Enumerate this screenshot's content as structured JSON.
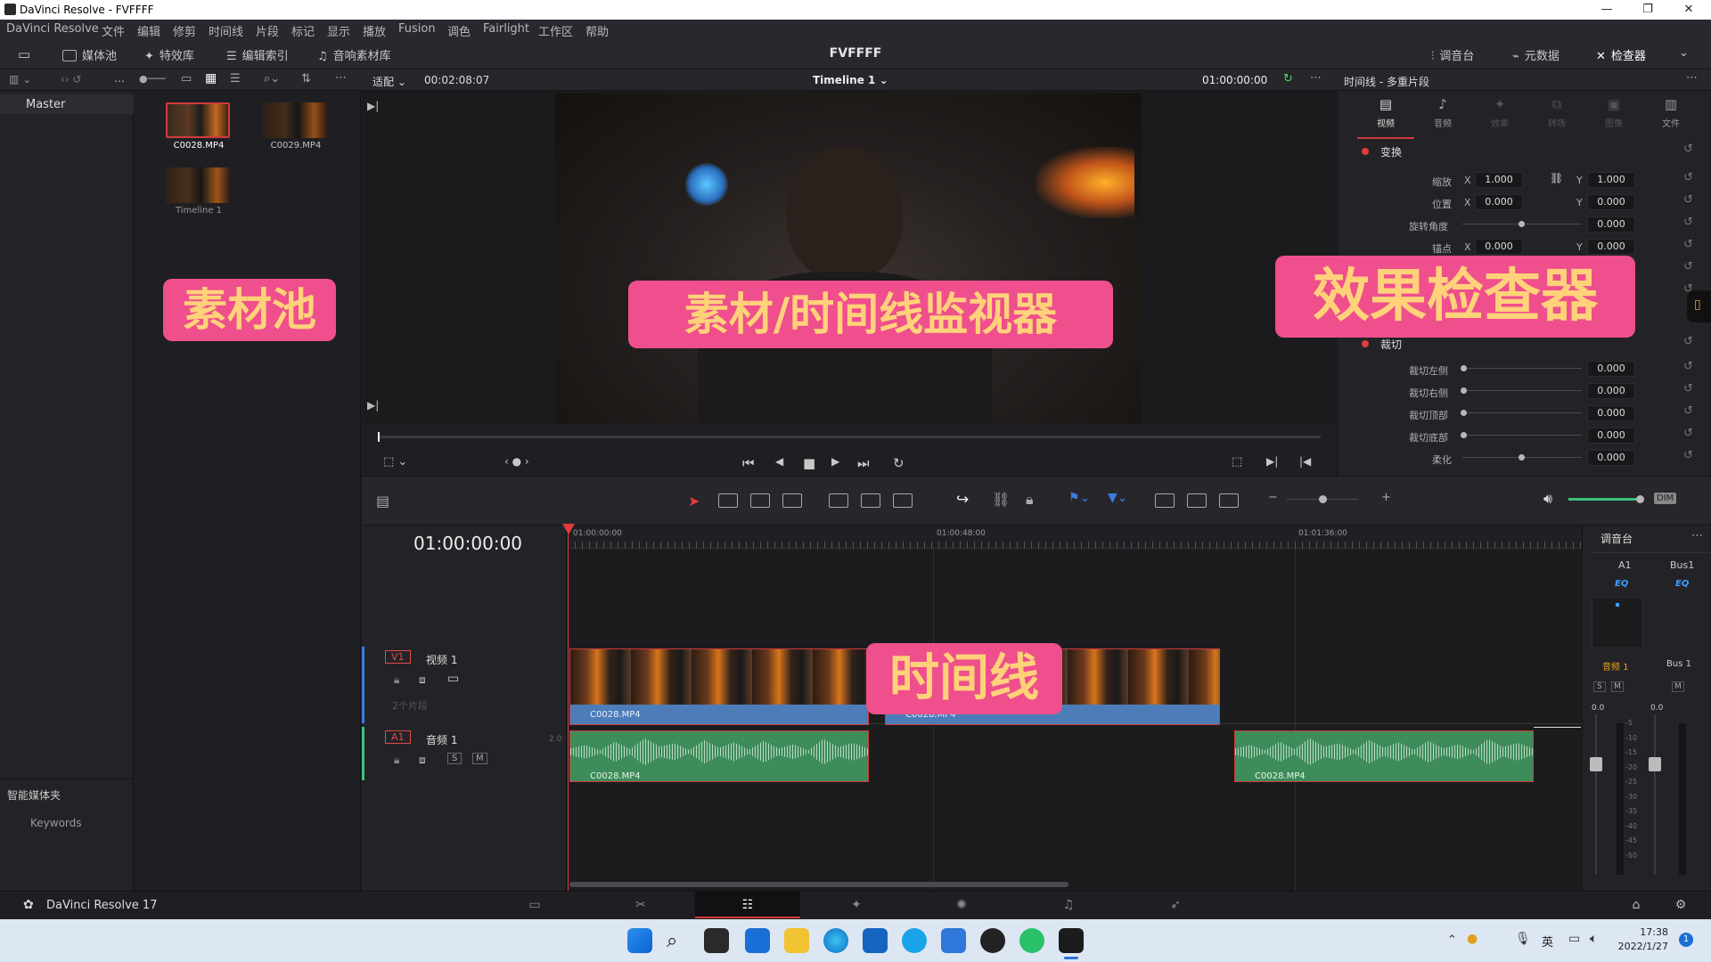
{
  "window": {
    "title": "DaVinci Resolve - FVFFFF",
    "controls": [
      "—",
      "❐",
      "✕"
    ]
  },
  "menu": [
    "DaVinci Resolve",
    "文件",
    "编辑",
    "修剪",
    "时间线",
    "片段",
    "标记",
    "显示",
    "播放",
    "Fusion",
    "调色",
    "Fairlight",
    "工作区",
    "帮助"
  ],
  "toolbar": {
    "media_pool": "媒体池",
    "effects": "特效库",
    "edit_index": "编辑索引",
    "sound_library": "音响素材库",
    "project_title": "FVFFFF",
    "mixer": "调音台",
    "metadata": "元数据",
    "inspector": "检查器"
  },
  "subbar": {
    "fit": "适配",
    "source_tc": "00:02:08:07",
    "timeline_name": "Timeline 1",
    "record_tc": "01:00:00:00",
    "inspector_title": "时间线 - 多重片段"
  },
  "bins": {
    "master": "Master",
    "smart_bins": "智能媒体夹",
    "keywords": "Keywords"
  },
  "media": {
    "clips": [
      {
        "name": "C0028.MP4"
      },
      {
        "name": "C0029.MP4"
      },
      {
        "name": "Timeline 1"
      }
    ]
  },
  "inspector": {
    "tabs": [
      "视频",
      "音频",
      "效果",
      "转场",
      "图像",
      "文件"
    ],
    "transform_label": "变换",
    "rows": [
      {
        "label": "缩放",
        "x": "1.000",
        "y": "1.000"
      },
      {
        "label": "位置",
        "x": "0.000",
        "y": "0.000"
      },
      {
        "label": "旋转角度",
        "value": "0.000"
      },
      {
        "label": "锚点",
        "x": "0.000",
        "y": "0.000"
      }
    ],
    "crop_label": "裁切",
    "crop_rows": [
      {
        "label": "裁切左侧",
        "value": "0.000"
      },
      {
        "label": "裁切右侧",
        "value": "0.000"
      },
      {
        "label": "裁切顶部",
        "value": "0.000"
      },
      {
        "label": "裁切底部",
        "value": "0.000"
      },
      {
        "label": "柔化",
        "value": "0.000"
      }
    ],
    "x_label": "X",
    "y_label": "Y"
  },
  "timeline": {
    "timecode": "01:00:00:00",
    "ruler": [
      "01:00:00:00",
      "01:00:48:00",
      "01:01:36:00"
    ],
    "video_track": {
      "id": "V1",
      "name": "视频 1",
      "clips_count": "2个片段"
    },
    "audio_track": {
      "id": "A1",
      "name": "音频 1",
      "channels": "2.0",
      "solo": "S",
      "mute": "M"
    },
    "clips": {
      "v1": "C0028.MP4",
      "v2": "C0028.MP4",
      "a1": "C0028.MP4",
      "a2": "C0028.MP4"
    }
  },
  "mixer": {
    "title": "调音台",
    "channels": [
      "A1",
      "Bus1"
    ],
    "eq": "EQ",
    "strip_names": [
      "音频 1",
      "Bus 1"
    ],
    "s": "S",
    "m": "M",
    "levels": [
      "0.0",
      "0.0"
    ],
    "scale": [
      "-5",
      "-10",
      "-15",
      "-20",
      "-25",
      "-30",
      "-35",
      "-40",
      "-45",
      "-50"
    ],
    "dim": "DIM"
  },
  "overlays": {
    "media_pool": "素材池",
    "viewer": "素材/时间线监视器",
    "inspector": "效果检查器",
    "timeline": "时间线"
  },
  "pagebar": {
    "app_name": "DaVinci Resolve 17"
  },
  "taskbar": {
    "time": "17:38",
    "date": "2022/1/27",
    "ime": "英",
    "notifications": "1"
  },
  "colors": {
    "accent_red": "#d13b3b",
    "callout_bg": "#ef4f8c",
    "callout_text": "#ffd27a",
    "video_clip": "#4d7db8",
    "audio_clip": "#3e8c5a"
  }
}
